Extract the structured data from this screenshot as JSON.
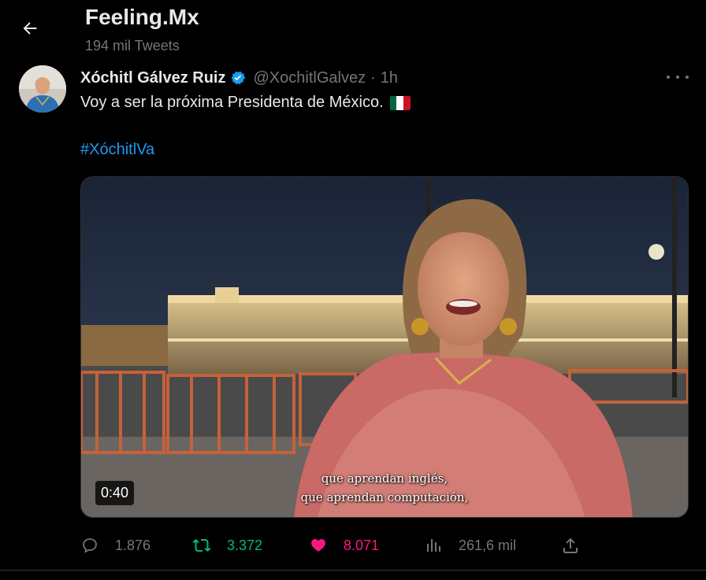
{
  "header": {
    "account_name": "Feeling.Mx",
    "tweet_count": "194 mil Tweets",
    "back_icon": "arrow-left-icon"
  },
  "tweet": {
    "display_name": "Xóchitl Gálvez Ruiz",
    "verified": true,
    "handle": "@XochitlGalvez",
    "separator": "·",
    "time": "1h",
    "text": "Voy a ser la próxima Presidenta de México.",
    "flag": "mexico-flag",
    "hashtag": "#XóchitlVa",
    "media": {
      "duration": "0:40",
      "subtitle_line1": "que aprendan inglés,",
      "subtitle_line2": "que aprendan computación,"
    },
    "actions": {
      "replies": "1.876",
      "retweets": "3.372",
      "likes": "8.071",
      "views": "261,6 mil"
    }
  },
  "colors": {
    "background": "#000000",
    "text_primary": "#e7e9ea",
    "text_secondary": "#71767b",
    "link": "#1d9bf0",
    "retweet": "#00ba7c",
    "like": "#f91880",
    "verified": "#1d9bf0"
  }
}
